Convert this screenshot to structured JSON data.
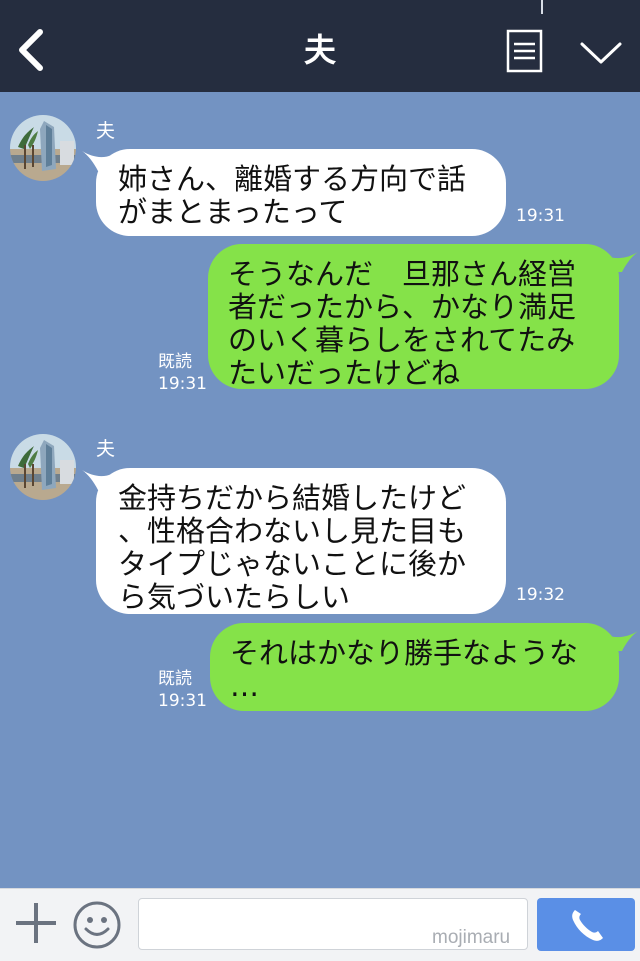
{
  "header": {
    "title": "夫",
    "back_icon": "chevron-left-icon",
    "menu_icon": "menu-list-icon",
    "collapse_icon": "chevron-down-icon"
  },
  "colors": {
    "header_bg": "#252d3f",
    "chat_bg": "#7393c2",
    "outgoing_bubble": "#85e249",
    "incoming_bubble": "#ffffff",
    "call_button": "#5a8fe6"
  },
  "messages": [
    {
      "direction": "incoming",
      "sender": "夫",
      "text": "姉さん、離婚する方向で話\nがまとまったって",
      "time": "19:31"
    },
    {
      "direction": "outgoing",
      "read": "既読",
      "time": "19:31",
      "text": "そうなんだ　旦那さん経営\n者だったから、かなり満足\nのいく暮らしをされてたみ\nたいだったけどね"
    },
    {
      "direction": "incoming",
      "sender": "夫",
      "text": "金持ちだから結婚したけど\n、性格合わないし見た目も\nタイプじゃないことに後か\nら気づいたらしい",
      "time": "19:32"
    },
    {
      "direction": "outgoing",
      "read": "既読",
      "time": "19:31",
      "text": "それはかなり勝手なような\n…"
    }
  ],
  "input": {
    "placeholder": "",
    "watermark": "mojimaru",
    "plus_icon": "plus-icon",
    "emoji_icon": "smiley-icon",
    "call_icon": "phone-icon"
  }
}
